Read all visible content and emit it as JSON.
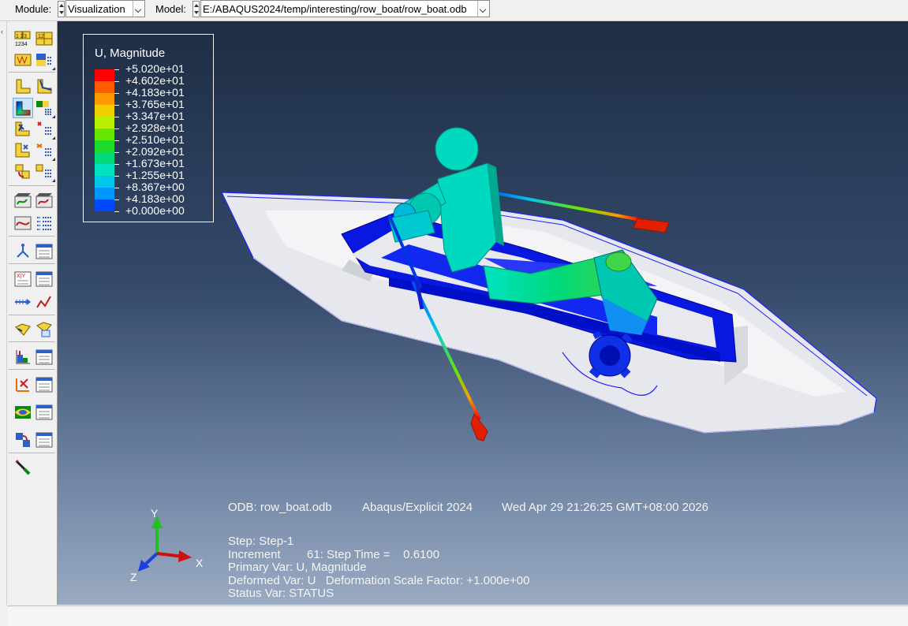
{
  "context_bar": {
    "module_label": "Module:",
    "module_value": "Visualization",
    "model_label": "Model:",
    "model_value": "E:/ABAQUS2024/temp/interesting/row_boat/row_boat.odb"
  },
  "toolbox": {
    "icons": [
      "probe-values-icon",
      "query-icon",
      "field-output-icon",
      "section-points-icon",
      "plot-undeformed-icon",
      "plot-deformed-icon",
      "plot-contours-icon",
      "contour-options-icon",
      "plot-symbols-icon",
      "symbol-options-icon",
      "plot-material-orientations-icon",
      "material-options-icon",
      "allow-multiple-plot-states-icon",
      "superimpose-options-icon",
      "animate-time-history-icon",
      "animation-options-icon",
      "animate-scale-factor-icon",
      "animation-player-icon",
      "view-cut-manager-icon",
      "view-cut-options-icon",
      "xy-data-manager-icon",
      "xy-plot-options-icon",
      "path-manager-icon",
      "plot-path-icon",
      "display-groups-icon",
      "display-group-manager-icon",
      "common-plot-options-icon",
      "odb-display-options-icon",
      "free-body-cut-icon",
      "free-body-manager-icon",
      "stream-plot-icon",
      "stream-manager-icon",
      "view-manipulation-icon",
      "view-manager-icon",
      "overlay-plot-icon"
    ]
  },
  "legend": {
    "title": "U, Magnitude",
    "labels": [
      "+5.020e+01",
      "+4.602e+01",
      "+4.183e+01",
      "+3.765e+01",
      "+3.347e+01",
      "+2.928e+01",
      "+2.510e+01",
      "+2.092e+01",
      "+1.673e+01",
      "+1.255e+01",
      "+8.367e+00",
      "+4.183e+00",
      "+0.000e+00"
    ],
    "colors": [
      "#ff0000",
      "#ff5d00",
      "#ff9a00",
      "#f2cf00",
      "#b9ef00",
      "#66e600",
      "#1fd92a",
      "#00d87a",
      "#00e2c2",
      "#00c8e8",
      "#0096ff",
      "#0048ff",
      "#0000ff"
    ]
  },
  "info": {
    "odb": "ODB: row_boat.odb",
    "solver": "Abaqus/Explicit 2024",
    "date": "Wed Apr 29 21:26:25 GMT+08:00 2026",
    "step": "Step: Step-1",
    "increment": "Increment        61: Step Time =    0.6100",
    "primary_var": "Primary Var: U, Magnitude",
    "deformed_var": "Deformed Var: U   Deformation Scale Factor: +1.000e+00",
    "status_var": "Status Var: STATUS"
  },
  "triad": {
    "x": "X",
    "y": "Y",
    "z": "Z"
  }
}
